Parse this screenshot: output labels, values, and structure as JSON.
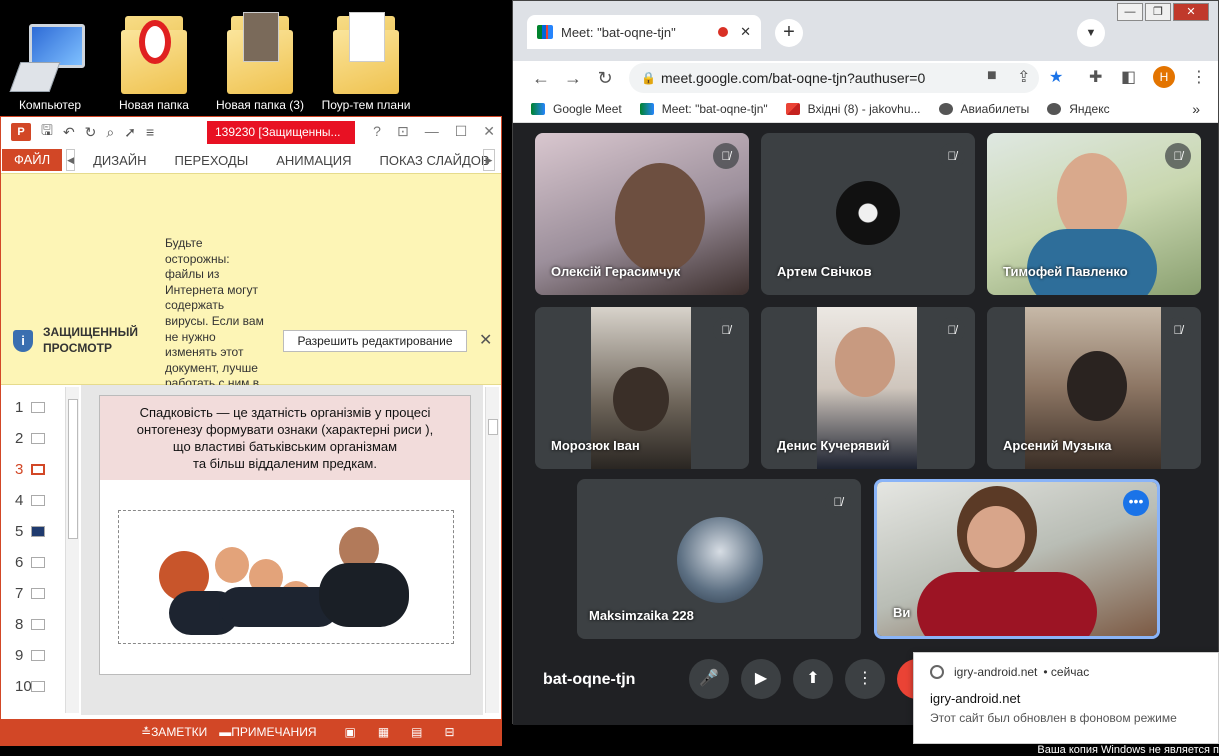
{
  "desktop": {
    "icons": [
      {
        "label": "Компьютер"
      },
      {
        "label": "Новая папка"
      },
      {
        "label": "Новая папка (3)"
      },
      {
        "label": "Поур-тем плани"
      }
    ],
    "watermark": "Ваша копия Windows не является п"
  },
  "powerpoint": {
    "logo_text": "P",
    "doc_title": "139230 [Защищенны...",
    "help": "?",
    "tabs": {
      "file": "ФАЙЛ",
      "items": [
        "ДИЗАЙН",
        "ПЕРЕХОДЫ",
        "АНИМАЦИЯ",
        "ПОКАЗ СЛАЙДОВ"
      ]
    },
    "protected_view": {
      "title": "ЗАЩИЩЕННЫЙ ПРОСМОТР",
      "message": "Будьте осторожны: файлы из Интернета могут содержать вирусы. Если вам не нужно изменять этот документ, лучше работать с ним в режиме защищенного просмотра.",
      "enable_button": "Разрешить редактирование",
      "close": "✕"
    },
    "thumbnails": [
      "1",
      "2",
      "3",
      "4",
      "5",
      "6",
      "7",
      "8",
      "9",
      "10"
    ],
    "active_thumbnail": 3,
    "slide": {
      "text_line1": "Спадковість — це здатність організмів у процесі",
      "text_line2": "онтогенезу формувати ознаки (характерні риси ),",
      "text_line3": "що властиві батьківським організмам",
      "text_line4": "та більш віддаленим предкам."
    },
    "status": {
      "notes": "ЗАМЕТКИ",
      "comments": "ПРИМЕЧАНИЯ"
    }
  },
  "chrome": {
    "tab_title": "Meet: \"bat-oqne-tjn\"",
    "tab_close": "✕",
    "new_tab": "+",
    "tab_search": "▼",
    "url": "meet.google.com/bat-oqne-tjn?authuser=0",
    "profile_initial": "Н",
    "bookmarks": [
      {
        "label": "Google Meet",
        "icon": "meet-icon"
      },
      {
        "label": "Meet: \"bat-oqne-tjn\"",
        "icon": "meet-icon"
      },
      {
        "label": "Вхідні (8) - jakovhu...",
        "icon": "gmail-icon"
      },
      {
        "label": "Авиабилеты",
        "icon": "globe-icon"
      },
      {
        "label": "Яндекс",
        "icon": "globe-icon"
      }
    ],
    "bookmarks_more": "»"
  },
  "meet": {
    "meeting_code": "bat-oqne-tjn",
    "participants": [
      {
        "name": "Олексій Герасимчук",
        "muted": true
      },
      {
        "name": "Артем Свічков",
        "muted": true
      },
      {
        "name": "Тимофей Павленко",
        "muted": true
      },
      {
        "name": "Морозюк Іван",
        "muted": true
      },
      {
        "name": "Денис Кучерявий",
        "muted": true
      },
      {
        "name": "Арсений Музыка",
        "muted": true
      },
      {
        "name": "Maksimzaika 228",
        "muted": true
      },
      {
        "name": "Ви",
        "muted": false
      }
    ],
    "active_color": "#8ab4f8",
    "end_call_color": "#ea4335"
  },
  "notification": {
    "source": "igry-android.net",
    "time": "• сейчас",
    "title": "igry-android.net",
    "body": "Этот сайт был обновлен в фоновом режиме"
  }
}
